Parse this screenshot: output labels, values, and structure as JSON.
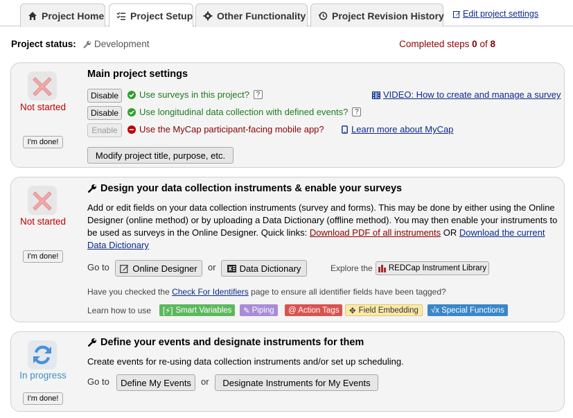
{
  "tabs": [
    {
      "label": "Project Home",
      "icon": "home-icon"
    },
    {
      "label": "Project Setup",
      "icon": "list-check-icon"
    },
    {
      "label": "Other Functionality",
      "icon": "gear-icon"
    },
    {
      "label": "Project Revision History",
      "icon": "history-icon"
    }
  ],
  "edit_link": "Edit project settings",
  "status": {
    "label": "Project status:",
    "value": "Development",
    "completed_prefix": "Completed steps",
    "completed_count": "0",
    "completed_of": "of",
    "completed_total": "8"
  },
  "steps": [
    {
      "state": "Not started",
      "done_label": "I'm done!",
      "title": "Main project settings",
      "options": [
        {
          "button": "Disable",
          "text": "Use surveys in this project?",
          "status": "enabled"
        },
        {
          "button": "Disable",
          "text": "Use longitudinal data collection with defined events?",
          "status": "enabled"
        },
        {
          "button": "Enable",
          "text": "Use the MyCap participant-facing mobile app?",
          "status": "disabled"
        }
      ],
      "video_link": "VIDEO: How to create and manage a survey",
      "mycap_link": "Learn more about MyCap",
      "modify_button": "Modify project title, purpose, etc."
    },
    {
      "state": "Not started",
      "done_label": "I'm done!",
      "title": "Design your data collection instruments & enable your surveys",
      "desc": "Add or edit fields on your data collection instruments (survey and forms). This may be done by either using the Online Designer (online method) or by uploading a Data Dictionary (offline method). You may then enable your instruments to be used as surveys in the Online Designer. Quick links:",
      "pdf_link": "Download PDF of all instruments",
      "or": "OR",
      "dict_link": "Download the current Data Dictionary",
      "goto": "Go to",
      "online_designer": "Online Designer",
      "or2": "or",
      "data_dictionary": "Data Dictionary",
      "explore": "Explore the",
      "library": "REDCap Instrument Library",
      "identifiers_pre": "Have you checked the",
      "identifiers_link": "Check For Identifiers",
      "identifiers_post": "page to ensure all identifier fields have been tagged?",
      "learn": "Learn how to use",
      "badges": [
        {
          "label": "Smart Variables",
          "color": "#5cb85c",
          "text_color": "#ffffff"
        },
        {
          "label": "Piping",
          "color": "#a98bd6",
          "text_color": "#ffffff"
        },
        {
          "label": "@ Action Tags",
          "color": "#d9534f",
          "text_color": "#ffffff"
        },
        {
          "label": "Field Embedding",
          "color": "#fbe9a8",
          "text_color": "#333333"
        },
        {
          "label": "Special Functions",
          "color": "#3a87c8",
          "text_color": "#ffffff"
        }
      ]
    },
    {
      "state": "In progress",
      "done_label": "I'm done!",
      "title": "Define your events and designate instruments for them",
      "desc": "Create events for re-using data collection instruments and/or set up scheduling.",
      "goto": "Go to",
      "define_button": "Define My Events",
      "or": "or",
      "designate_button": "Designate Instruments for My Events"
    }
  ]
}
